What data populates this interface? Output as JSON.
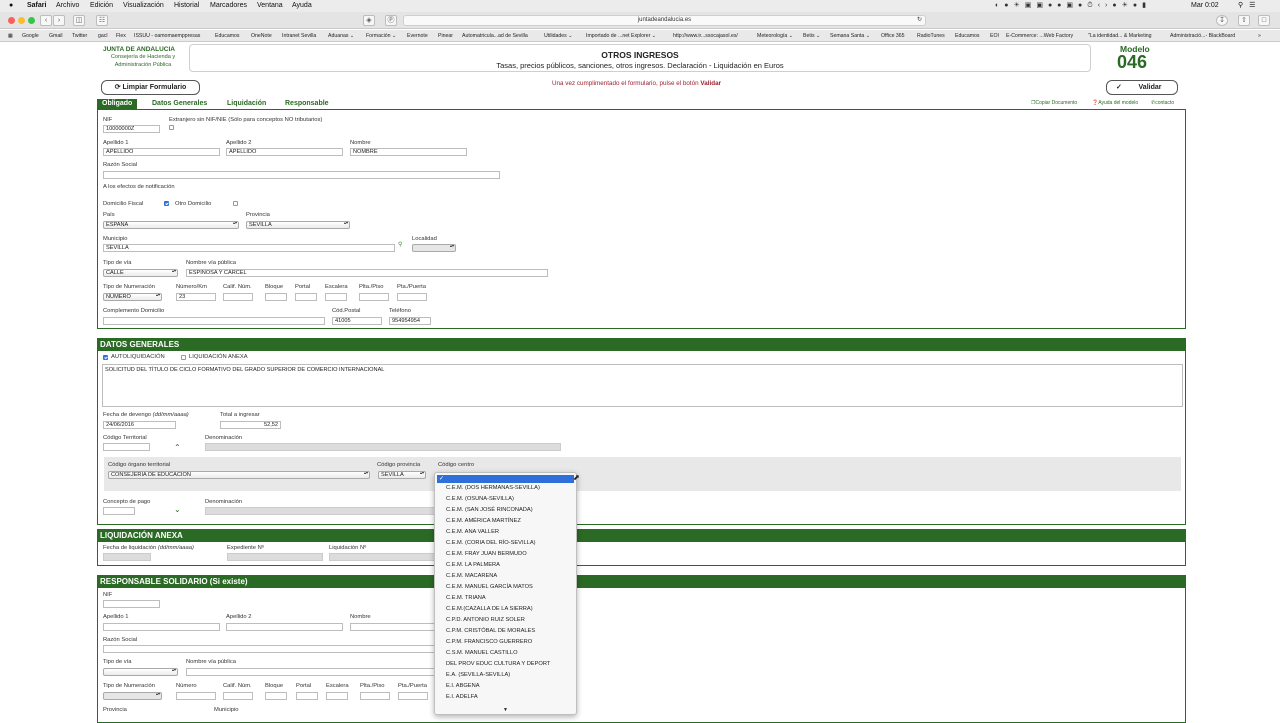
{
  "menubar": {
    "app": "Safari",
    "items": [
      "Archivo",
      "Edición",
      "Visualización",
      "Historial",
      "Marcadores",
      "Ventana",
      "Ayuda"
    ],
    "clock": "Mar 0:02"
  },
  "browser": {
    "url": "juntadeandalucia.es",
    "bookmarks": [
      "Google",
      "Gmail",
      "Twitter",
      "gacl",
      "Flex",
      "ISSUU - oamomaemppresas",
      "Educamos",
      "OneNote",
      "Intranet Sevilla",
      "Aduanas ⌄",
      "Formación ⌄",
      "Evernote",
      "Pinear",
      "Automatricula...ad de Sevilla",
      "Utilidades ⌄",
      "Importado de ...net Explorer ⌄",
      "http://www.ir...ssocajasol.es/",
      "Meteorología ⌄",
      "Betis ⌄",
      "Semana Santa ⌄",
      "Office 365",
      "RadioTunes",
      "Educamos",
      "EOI",
      "E-Commerce: ...Web Factory",
      "\"La identidad... & Marketing",
      "Administració...- BlackBoard"
    ]
  },
  "header": {
    "org_title": "JUNTA DE ANDALUCIA",
    "org_sub": "Consejería de Hacienda y Administración Pública",
    "form_title": "OTROS INGRESOS",
    "form_subtitle": "Tasas, precios públicos, sanciones, otros ingresos. Declaración - Liquidación en Euros",
    "modelo_label": "Modelo",
    "modelo_number": "046",
    "clear_button": "Limpiar Formulario",
    "validate_button": "Validar",
    "warning_text": "Una vez cumplimentado el formulario, pulse el botón",
    "warning_bold": "Validar"
  },
  "tabs": [
    "Obligado",
    "Datos Generales",
    "Liquidación",
    "Responsable"
  ],
  "top_links": [
    "Copiar Documento",
    "Ayuda del modelo",
    "contacto"
  ],
  "obligado": {
    "nif_label": "NIF",
    "nif_value": "10000000Z",
    "extranjero_label": "Extranjero sin NIF/NIE (Sólo para conceptos NO tributarios)",
    "apellido1_label": "Apellido 1",
    "apellido1_value": "APELLIDO",
    "apellido2_label": "Apellido 2",
    "apellido2_value": "APELLIDO",
    "nombre_label": "Nombre",
    "nombre_value": "NOMBRE",
    "razon_label": "Razón Social",
    "notif_label": "A los efectos de notificación",
    "domicilio_fiscal_label": "Domicilio Fiscal",
    "otro_domicilio_label": "Otro Domicilio",
    "pais_label": "País",
    "pais_value": "ESPAÑA",
    "provincia_label": "Provincia",
    "provincia_value": "SEVILLA",
    "municipio_label": "Municipio",
    "municipio_value": "SEVILLA",
    "localidad_label": "Localidad",
    "tipo_via_label": "Tipo de vía",
    "tipo_via_value": "CALLE",
    "nombre_via_label": "Nombre vía pública",
    "nombre_via_value": "ESPINOSA Y CÁRCEL",
    "tipo_num_label": "Tipo de Numeración",
    "tipo_num_value": "NÚMERO",
    "numero_label": "Número/Km",
    "numero_value": "23",
    "calif_label": "Calif. Núm.",
    "bloque_label": "Bloque",
    "portal_label": "Portal",
    "escalera_label": "Escalera",
    "planta_label": "Plta./Piso",
    "puerta_label": "Pta./Puerta",
    "complemento_label": "Complemento Domicilio",
    "cp_label": "Cód.Postal",
    "cp_value": "41005",
    "telefono_label": "Teléfono",
    "telefono_value": "954954954"
  },
  "datos_generales": {
    "title": "DATOS GENERALES",
    "autoliq_label": "AUTOLIQUIDACIÓN",
    "liq_anexa_label": "LIQUIDACIÓN ANEXA",
    "descripcion": "SOLICITUD DEL TÍTULO DE CICLO FORMATIVO DEL GRADO SUPERIOR DE COMERCIO INTERNACIONAL",
    "fecha_label": "Fecha de devengo",
    "fecha_hint": "(dd/mm/aaaa)",
    "fecha_value": "24/06/2016",
    "total_label": "Total a ingresar",
    "total_value": "52,52",
    "cod_territorial_label": "Código Territorial",
    "denominacion_label": "Denominación",
    "organo_label": "Código órgano territorial",
    "organo_value": "CONSEJERIA DE EDUCACIÓN",
    "cod_provincia_label": "Código provincia",
    "cod_provincia_value": "SEVILLA",
    "cod_centro_label": "Código centro",
    "concepto_label": "Concepto de pago",
    "denominacion2_label": "Denominación"
  },
  "liquidacion_anexa": {
    "title": "LIQUIDACIÓN ANEXA",
    "fecha_label": "Fecha de liquidación",
    "fecha_hint": "(dd/mm/aaaa)",
    "expediente_label": "Expediente Nº",
    "liquidacion_label": "Liquidación Nº"
  },
  "responsable": {
    "title": "RESPONSABLE SOLIDARIO (Si existe)",
    "nif_label": "NIF",
    "apellido1_label": "Apellido 1",
    "apellido2_label": "Apellido 2",
    "nombre_label": "Nombre",
    "razon_label": "Razón Social",
    "tipo_via_label": "Tipo de vía",
    "nombre_via_label": "Nombre vía pública",
    "tipo_num_label": "Tipo de Numeración",
    "numero_label": "Número",
    "calif_label": "Calif. Núm.",
    "bloque_label": "Bloque",
    "portal_label": "Portal",
    "escalera_label": "Escalera",
    "planta_label": "Plta./Piso",
    "puerta_label": "Pta./Puerta",
    "provincia_label": "Provincia",
    "municipio_label": "Municipio"
  },
  "dropdown": {
    "selected": "",
    "options": [
      "C.E.M. (DOS HERMANAS-SEVILLA)",
      "C.E.M. (OSUNA-SEVILLA)",
      "C.E.M. (SAN JOSÉ RINCONADA)",
      "C.E.M. AMÉRICA MARTÍNEZ",
      "C.E.M. ANA VALLER",
      "C.E.M. (CORIA DEL RÍO-SEVILLA)",
      "C.E.M. FRAY JUAN BERMUDO",
      "C.E.M. LA PALMERA",
      "C.E.M. MACARENA",
      "C.E.M. MANUEL GARCÍA MATOS",
      "C.E.M. TRIANA",
      "C.E.M.(CAZALLA DE LA SIERRA)",
      "C.P.D. ANTONIO RUIZ SOLER",
      "C.P.M. CRISTÓBAL DE MORALES",
      "C.P.M. FRANCISCO GUERRERO",
      "C.S.M. MANUEL CASTILLO",
      "DEL PROV EDUC CULTURA Y DEPORT",
      "E.A. (SEVILLA-SEVILLA)",
      "E.I. ABGENA",
      "E.I. ADELFA"
    ]
  }
}
